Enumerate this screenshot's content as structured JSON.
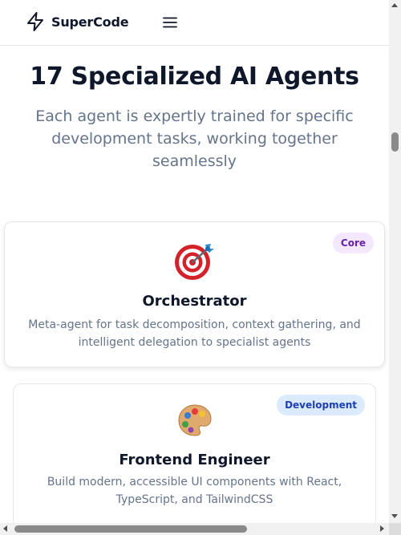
{
  "header": {
    "logo_text": "SuperCode",
    "logo_icon": "lightning-bolt-icon",
    "menu_icon": "hamburger-menu-icon"
  },
  "hero": {
    "title": "17 Specialized AI Agents",
    "subtitle": "Each agent is expertly trained for specific development tasks, working together seamlessly"
  },
  "agents": [
    {
      "icon": "direct-hit-target-icon",
      "badge": "Core",
      "name": "Orchestrator",
      "description": "Meta-agent for task decomposition, context gathering, and intelligent delegation to specialist agents"
    },
    {
      "icon": "artist-palette-icon",
      "badge": "Development",
      "name": "Frontend Engineer",
      "description": "Build modern, accessible UI components with React, TypeScript, and TailwindCSS"
    }
  ],
  "colors": {
    "text_primary": "#0f172a",
    "text_secondary": "#64748b",
    "border": "#e5e7eb",
    "badge_core_bg": "#f3e8ff",
    "badge_core_text": "#6b21a8",
    "badge_dev_bg": "#dbeafe",
    "badge_dev_text": "#1e40af"
  }
}
